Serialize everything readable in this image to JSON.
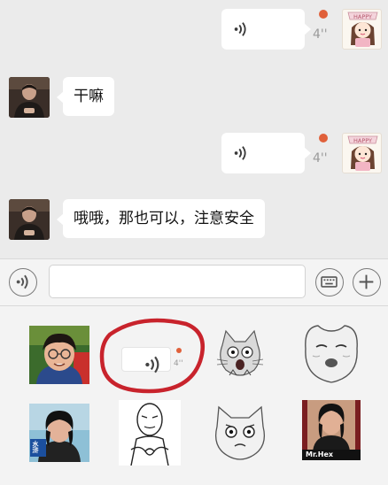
{
  "chat": {
    "messages": [
      {
        "side": "self",
        "type": "voice",
        "duration": "4''",
        "unread": true
      },
      {
        "side": "other",
        "type": "text",
        "text": "干嘛"
      },
      {
        "side": "self",
        "type": "voice",
        "duration": "4''",
        "unread": true
      },
      {
        "side": "other",
        "type": "text",
        "text": "哦哦，那也可以，注意安全"
      }
    ],
    "self_avatar_text": "HAPPY"
  },
  "input_bar": {
    "text_value": "",
    "voice_icon": "voice-waves-icon",
    "keyboard_icon": "keyboard-icon",
    "plus_icon": "plus-icon"
  },
  "sticker_panel": {
    "stickers": [
      {
        "name": "boy-glasses-photo"
      },
      {
        "name": "voice-message-sticker",
        "duration": "4''"
      },
      {
        "name": "shocked-cat"
      },
      {
        "name": "round-face-meme"
      },
      {
        "name": "woman-photo-tv",
        "tag": "水浒"
      },
      {
        "name": "meme-man-heart-hands"
      },
      {
        "name": "angry-cat-face"
      },
      {
        "name": "woman-photo-mrhex",
        "tag": "Mr.Hex"
      }
    ]
  },
  "colors": {
    "background": "#ebebeb",
    "bubble": "#ffffff",
    "unread_dot": "#e0603a",
    "red_circle": "#c8232c"
  }
}
